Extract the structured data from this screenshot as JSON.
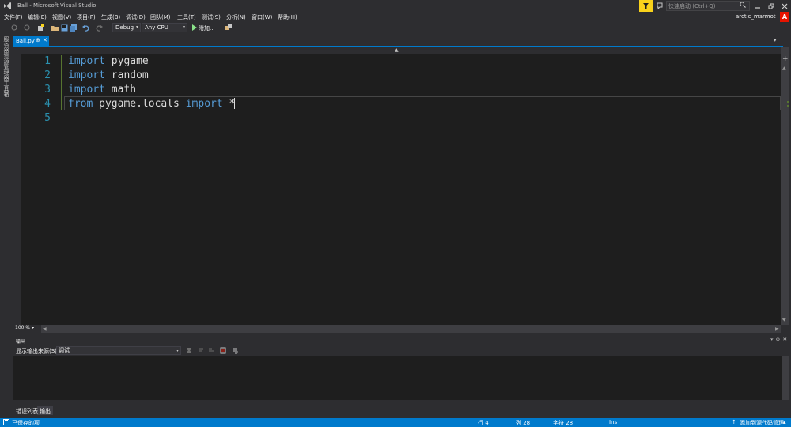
{
  "window": {
    "title": "Ball - Microsoft Visual Studio",
    "quick_launch_placeholder": "快速启动 (Ctrl+Q)",
    "user": "arctic_marmot",
    "avatar_letter": "A",
    "accent_color": "#007acc",
    "notification_color": "#f9d21b"
  },
  "menu": {
    "items": [
      "文件(F)",
      "编辑(E)",
      "视图(V)",
      "项目(P)",
      "生成(B)",
      "调试(D)",
      "团队(M)",
      "工具(T)",
      "测试(S)",
      "分析(N)",
      "窗口(W)",
      "帮助(H)"
    ]
  },
  "toolbar": {
    "configuration": "Debug",
    "platform": "Any CPU",
    "start_label": "附加...",
    "icons": [
      "back-icon",
      "forward-icon",
      "new-project-icon",
      "open-file-icon",
      "save-icon",
      "save-all-icon",
      "undo-icon",
      "redo-icon",
      "start-icon",
      "attach-icon"
    ]
  },
  "side_rail": {
    "tabs": [
      "服务器资源管理器",
      "工具箱"
    ]
  },
  "document": {
    "tab_label": "Ball.py",
    "pin_glyph": "⊕",
    "close_glyph": "✕"
  },
  "editor": {
    "lines": [
      {
        "number": "1",
        "tokens": [
          {
            "text": "import",
            "kind": "kw"
          },
          {
            "text": " pygame",
            "kind": "ident"
          }
        ]
      },
      {
        "number": "2",
        "tokens": [
          {
            "text": "import",
            "kind": "kw"
          },
          {
            "text": " random",
            "kind": "ident"
          }
        ]
      },
      {
        "number": "3",
        "tokens": [
          {
            "text": "import",
            "kind": "kw"
          },
          {
            "text": " math",
            "kind": "ident"
          }
        ]
      },
      {
        "number": "4",
        "tokens": [
          {
            "text": "from",
            "kind": "kw"
          },
          {
            "text": " pygame.locals ",
            "kind": "ident"
          },
          {
            "text": "import",
            "kind": "kw"
          },
          {
            "text": " *",
            "kind": "plain"
          }
        ]
      },
      {
        "number": "5",
        "tokens": []
      }
    ],
    "zoom": "100 %"
  },
  "output": {
    "title": "输出",
    "source_label": "显示输出来源(S):",
    "source_value": "调试"
  },
  "tool_tabs": [
    "错误列表",
    "输出"
  ],
  "statusbar": {
    "message": "已保存的项",
    "line": "行 4",
    "column": "列 28",
    "char": "字符 28",
    "mode": "Ins",
    "source_control": "添加到源代码管理"
  }
}
